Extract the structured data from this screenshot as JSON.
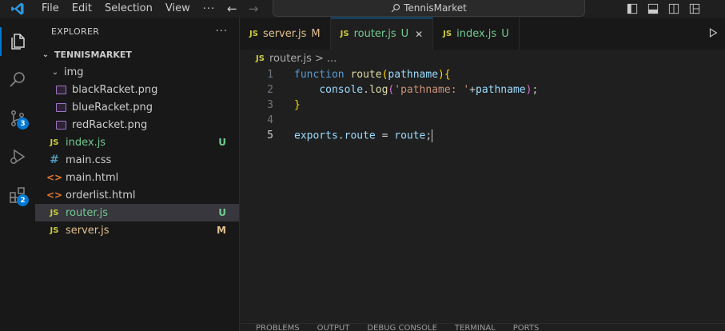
{
  "menu": {
    "file": "File",
    "edit": "Edit",
    "selection": "Selection",
    "view": "View",
    "more": "···"
  },
  "search": {
    "label": "TennisMarket"
  },
  "sidebar": {
    "title": "EXPLORER",
    "more": "···",
    "folder": "TENNISMARKET",
    "items": [
      {
        "name": "img",
        "type": "folder"
      },
      {
        "name": "blackRacket.png",
        "type": "png"
      },
      {
        "name": "blueRacket.png",
        "type": "png"
      },
      {
        "name": "redRacket.png",
        "type": "png"
      },
      {
        "name": "index.js",
        "type": "js",
        "status": "U"
      },
      {
        "name": "main.css",
        "type": "css"
      },
      {
        "name": "main.html",
        "type": "html"
      },
      {
        "name": "orderlist.html",
        "type": "html"
      },
      {
        "name": "router.js",
        "type": "js",
        "status": "U"
      },
      {
        "name": "server.js",
        "type": "js",
        "status": "M"
      }
    ]
  },
  "activity": {
    "scm_badge": "3",
    "extensions_badge": "2"
  },
  "tabs": [
    {
      "icon": "JS",
      "label": "server.js",
      "status": "M"
    },
    {
      "icon": "JS",
      "label": "router.js",
      "status": "U",
      "close": "✕"
    },
    {
      "icon": "JS",
      "label": "index.js",
      "status": "U"
    }
  ],
  "breadcrumb": {
    "icon": "JS",
    "file": "router.js",
    "sep": ">",
    "rest": "..."
  },
  "code": {
    "line_numbers": [
      "1",
      "2",
      "3",
      "4",
      "5"
    ]
  },
  "panel": {
    "tabs": [
      "PROBLEMS",
      "OUTPUT",
      "DEBUG CONSOLE",
      "TERMINAL",
      "PORTS"
    ]
  },
  "colors": {
    "accent": "#0078d4",
    "untracked": "#73c991",
    "modified": "#e2c08d"
  }
}
